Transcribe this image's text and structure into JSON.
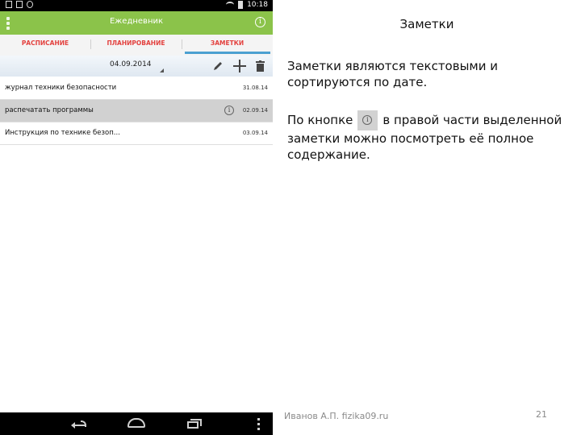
{
  "status_bar": {
    "time": "10:18"
  },
  "app": {
    "title": "Ежедневник",
    "info_glyph": "i"
  },
  "tabs": [
    {
      "label": "РАСПИСАНИЕ",
      "active": false
    },
    {
      "label": "ПЛАНИРОВАНИЕ",
      "active": false
    },
    {
      "label": "ЗАМЕТКИ",
      "active": true
    }
  ],
  "toolbar": {
    "date": "04.09.2014"
  },
  "notes": [
    {
      "title": "журнал техники безопасности",
      "date": "31.08.14",
      "selected": false
    },
    {
      "title": "распечатать программы",
      "date": "02.09.14",
      "selected": true
    },
    {
      "title": "Инструкция по технике безоп...",
      "date": "03.09.14",
      "selected": false
    }
  ],
  "slide": {
    "title": "Заметки",
    "para1": "Заметки являются текстовыми и сортируются по дате.",
    "para2_before": "По кнопке",
    "para2_after": "в правой части выделенной заметки можно посмотреть её полное содержание.",
    "info_glyph": "i",
    "footer_author": "Иванов А.П. fizika09.ru",
    "page_number": "21"
  },
  "colors": {
    "app_bar": "#8bc34a",
    "tab_text": "#e3413e",
    "tab_indicator": "#4ba0d1",
    "selected_row": "#d1d1d1"
  }
}
